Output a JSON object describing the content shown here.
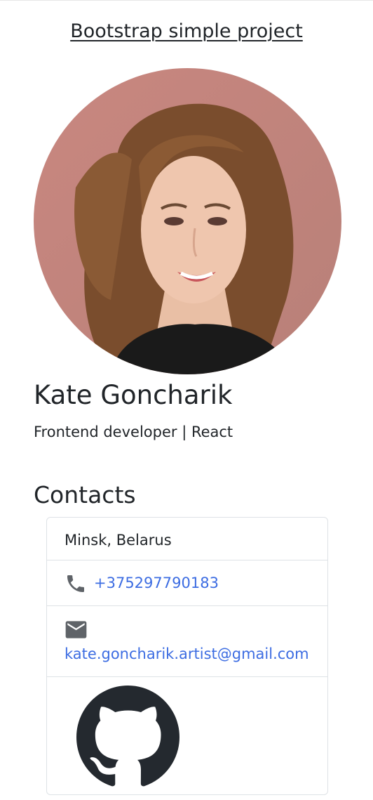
{
  "header": {
    "title": "Bootstrap simple project"
  },
  "profile": {
    "name": "Kate Goncharik",
    "role": "Frontend developer | React"
  },
  "contacts": {
    "heading": "Contacts",
    "location": "Minsk, Belarus",
    "phone": "+375297790183",
    "email": "kate.goncharik.artist@gmail.com"
  },
  "colors": {
    "text": "#212529",
    "link": "#3d6de2",
    "border": "#dee2e6",
    "icon": "#5f6368",
    "avatar_bg": "#c4847c"
  },
  "icons": [
    "phone-icon",
    "mail-icon",
    "github-icon"
  ]
}
